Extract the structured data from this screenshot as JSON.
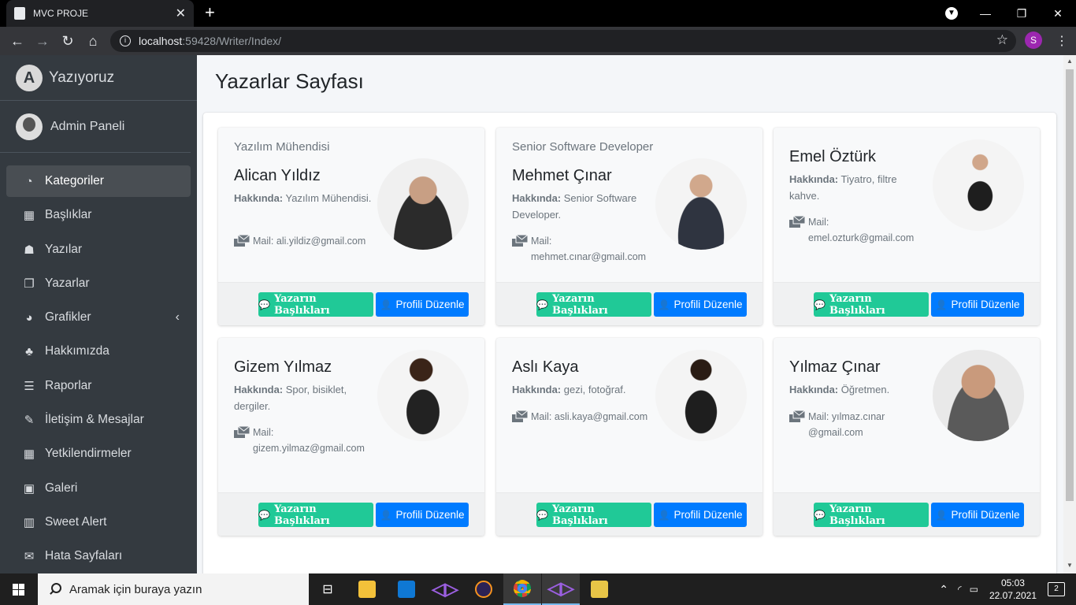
{
  "browser": {
    "tab_title": "MVC PROJE",
    "url_host": "localhost",
    "url_path": ":59428/Writer/Index/",
    "profile_initial": "S"
  },
  "sidebar": {
    "brand": "Yazıyoruz",
    "brand_logo": "A",
    "user": "Admin Paneli",
    "items": [
      {
        "label": "Kategoriler",
        "icon": "dashboard-icon",
        "glyph": "◔",
        "active": true
      },
      {
        "label": "Başlıklar",
        "icon": "grid-icon",
        "glyph": "▦"
      },
      {
        "label": "Yazılar",
        "icon": "book-reader-icon",
        "glyph": "☗"
      },
      {
        "label": "Yazarlar",
        "icon": "copy-icon",
        "glyph": "❐"
      },
      {
        "label": "Grafikler",
        "icon": "pie-chart-icon",
        "glyph": "◕",
        "caret": "‹"
      },
      {
        "label": "Hakkımızda",
        "icon": "tree-icon",
        "glyph": "♣"
      },
      {
        "label": "Raporlar",
        "icon": "bars-icon",
        "glyph": "☰"
      },
      {
        "label": "İletişim & Mesajlar",
        "icon": "edit-icon",
        "glyph": "✎"
      },
      {
        "label": "Yetkilendirmeler",
        "icon": "calendar-icon",
        "glyph": "▦"
      },
      {
        "label": "Galeri",
        "icon": "image-icon",
        "glyph": "▣"
      },
      {
        "label": "Sweet Alert",
        "icon": "map-icon",
        "glyph": "▥"
      },
      {
        "label": "Hata Sayfaları",
        "icon": "envelope-icon",
        "glyph": "✉"
      }
    ]
  },
  "page": {
    "title": "Yazarlar Sayfası",
    "about_label": "Hakkında:",
    "mail_label": "Mail:",
    "btn_titles": "Yazarın Başlıkları",
    "btn_edit": "Profili Düzenle"
  },
  "writers": [
    {
      "role": "Yazılım Mühendisi",
      "name": "Alican Yıldız",
      "about": "Yazılım Mühendisi.",
      "mail": "ali.yildiz@gmail.com"
    },
    {
      "role": "Senior Software Developer",
      "name": "Mehmet Çınar",
      "about": "Senior Software Developer.",
      "mail": "mehmet.cınar@gmail.com"
    },
    {
      "role": "",
      "name": "Emel Öztürk",
      "about": "Tiyatro, filtre kahve.",
      "mail": "emel.ozturk@gmail.com"
    },
    {
      "role": "",
      "name": "Gizem Yılmaz",
      "about": "Spor, bisiklet, dergiler.",
      "mail": "gizem.yilmaz@gmail.com"
    },
    {
      "role": "",
      "name": "Aslı Kaya",
      "about": "gezi, fotoğraf.",
      "mail": "asli.kaya@gmail.com"
    },
    {
      "role": "",
      "name": "Yılmaz Çınar",
      "about": "Öğretmen.",
      "mail": "yılmaz.cınar @gmail.com"
    }
  ],
  "taskbar": {
    "search_placeholder": "Aramak için buraya yazın",
    "time": "05:03",
    "date": "22.07.2021",
    "notifications": "2"
  }
}
